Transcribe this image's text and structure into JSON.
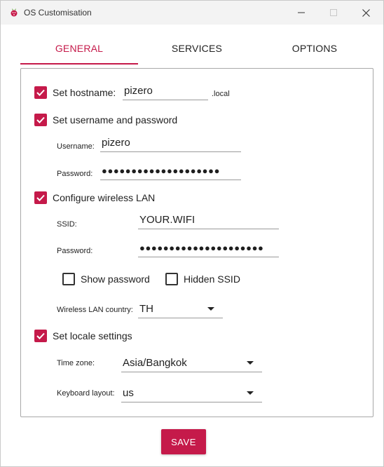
{
  "window": {
    "title": "OS Customisation"
  },
  "colors": {
    "accent": "#c51a4a"
  },
  "tabs": [
    {
      "label": "GENERAL",
      "active": true
    },
    {
      "label": "SERVICES",
      "active": false
    },
    {
      "label": "OPTIONS",
      "active": false
    }
  ],
  "general": {
    "hostname": {
      "label": "Set hostname:",
      "checked": true,
      "value": "pizero",
      "suffix": ".local"
    },
    "user": {
      "label": "Set username and password",
      "checked": true,
      "username_label": "Username:",
      "username": "pizero",
      "password_label": "Password:",
      "password": "●●●●●●●●●●●●●●●●●●●●"
    },
    "wifi": {
      "label": "Configure wireless LAN",
      "checked": true,
      "ssid_label": "SSID:",
      "ssid": "YOUR.WIFI",
      "password_label": "Password:",
      "password": "●●●●●●●●●●●●●●●●●●●●●",
      "show_password": {
        "label": "Show password",
        "checked": false
      },
      "hidden_ssid": {
        "label": "Hidden SSID",
        "checked": false
      },
      "country_label": "Wireless LAN country:",
      "country": "TH"
    },
    "locale": {
      "label": "Set locale settings",
      "checked": true,
      "timezone_label": "Time zone:",
      "timezone": "Asia/Bangkok",
      "keyboard_label": "Keyboard layout:",
      "keyboard": "us"
    }
  },
  "save_label": "SAVE"
}
